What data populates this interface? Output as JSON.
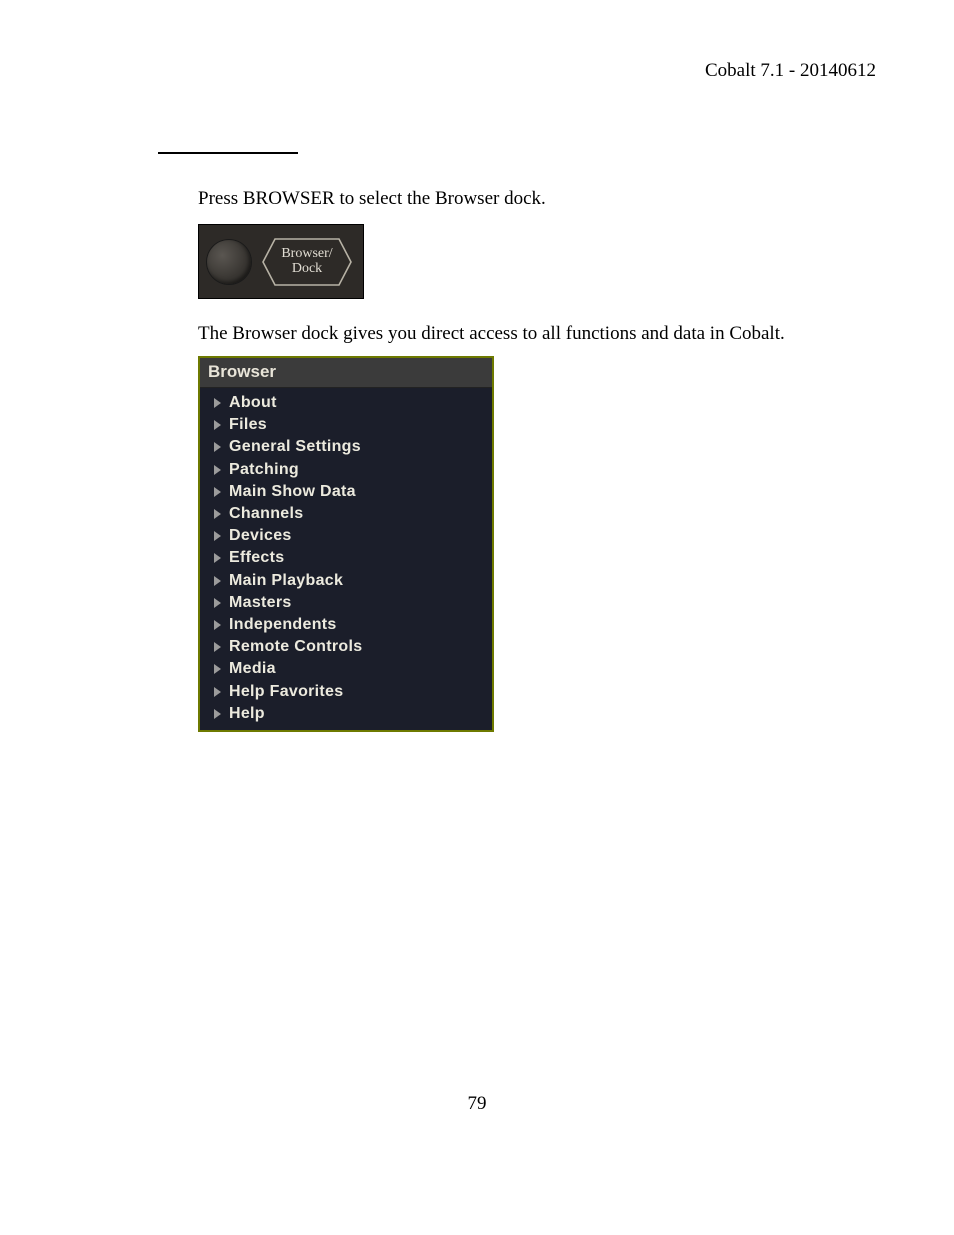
{
  "header": {
    "version_line": "Cobalt 7.1 - 20140612"
  },
  "paragraphs": {
    "p1": "Press BROWSER to select the Browser dock.",
    "p2": "The Browser dock gives you direct access to all functions and data in Cobalt."
  },
  "button_figure": {
    "line1": "Browser/",
    "line2": "Dock"
  },
  "browser_panel": {
    "title": "Browser",
    "items": [
      "About",
      "Files",
      "General Settings",
      "Patching",
      "Main Show Data",
      "Channels",
      "Devices",
      "Effects",
      "Main Playback",
      "Masters",
      "Independents",
      "Remote Controls",
      "Media",
      "Help Favorites",
      "Help"
    ]
  },
  "page_number": "79"
}
